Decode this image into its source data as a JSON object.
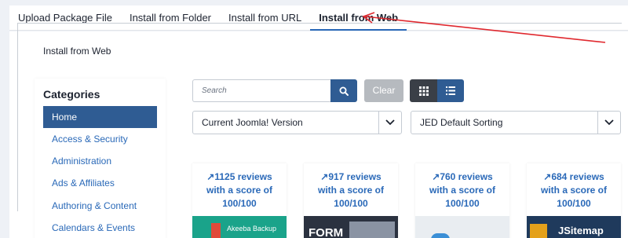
{
  "tabs": [
    {
      "label": "Upload Package File"
    },
    {
      "label": "Install from Folder"
    },
    {
      "label": "Install from URL"
    },
    {
      "label": "Install from Web"
    }
  ],
  "legend": "Install from Web",
  "categories": {
    "title": "Categories",
    "items": [
      {
        "label": "Home"
      },
      {
        "label": "Access & Security"
      },
      {
        "label": "Administration"
      },
      {
        "label": "Ads & Affiliates"
      },
      {
        "label": "Authoring & Content"
      },
      {
        "label": "Calendars & Events"
      }
    ]
  },
  "search": {
    "placeholder": "Search",
    "clear_label": "Clear"
  },
  "filters": {
    "version": "Current Joomla! Version",
    "sorting": "JED Default Sorting"
  },
  "cards": [
    {
      "line1": "1125 reviews",
      "line2": "with a score of",
      "line3": "100/100",
      "image_text": "Akeeba Backup"
    },
    {
      "line1": "917 reviews",
      "line2": "with a score of",
      "line3": "100/100",
      "image_text": "FORM"
    },
    {
      "line1": "760 reviews",
      "line2": "with a score of",
      "line3": "100/100",
      "image_text": ""
    },
    {
      "line1": "684 reviews",
      "line2": "with a score of",
      "line3": "100/100",
      "image_text": "JSitemap"
    }
  ],
  "colors": {
    "accent": "#2f5c93",
    "link": "#2a69b8",
    "annotation": "#e0282e"
  }
}
